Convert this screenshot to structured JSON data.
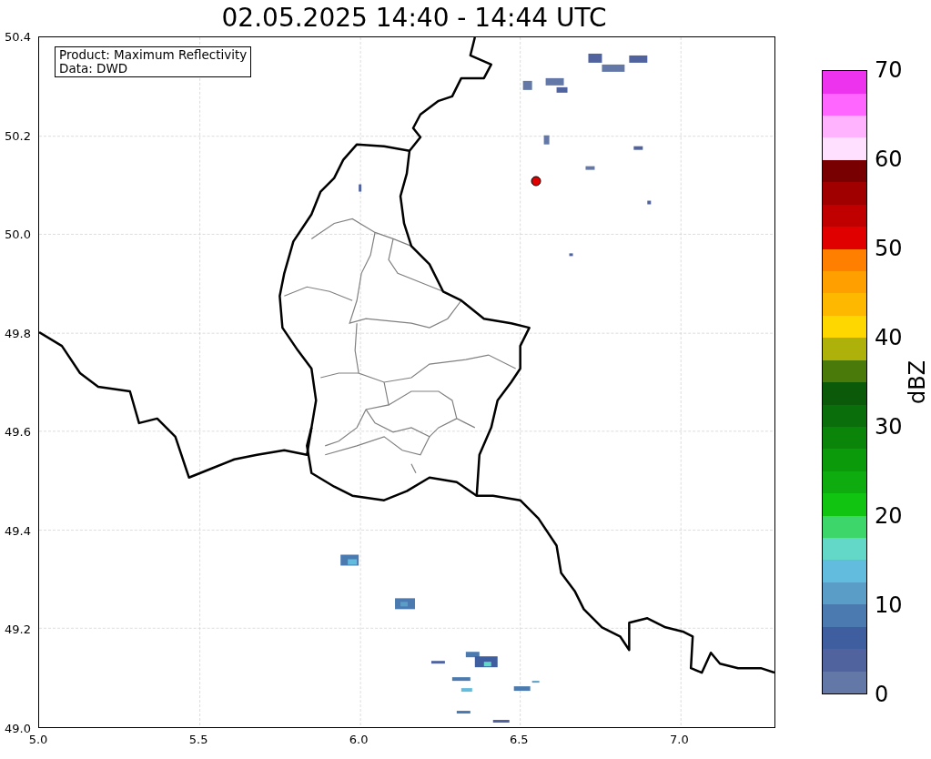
{
  "title": "02.05.2025 14:40 - 14:44 UTC",
  "info_box": [
    "Product: Maximum Reflectivity",
    "Data: DWD"
  ],
  "x_ticks": [
    "5.0",
    "5.5",
    "6.0",
    "6.5",
    "7.0"
  ],
  "y_ticks": [
    "50.4",
    "50.2",
    "50.0",
    "49.8",
    "49.6",
    "49.4",
    "49.2",
    "49.0"
  ],
  "colorbar": {
    "label": "dBZ",
    "ticks": [
      "70",
      "60",
      "50",
      "40",
      "30",
      "20",
      "10",
      "0"
    ],
    "bands": [
      {
        "color": "#6478a8"
      },
      {
        "color": "#50639f"
      },
      {
        "color": "#3f5ea0"
      },
      {
        "color": "#4a7ab0"
      },
      {
        "color": "#5a9ec8"
      },
      {
        "color": "#62bcde"
      },
      {
        "color": "#63d7c8"
      },
      {
        "color": "#3dd66a"
      },
      {
        "color": "#12c412"
      },
      {
        "color": "#0eac0e"
      },
      {
        "color": "#0a9a0a"
      },
      {
        "color": "#0a850a"
      },
      {
        "color": "#0a6e0a"
      },
      {
        "color": "#0a5a0a"
      },
      {
        "color": "#4a7a0a"
      },
      {
        "color": "#adb10a"
      },
      {
        "color": "#ffd700"
      },
      {
        "color": "#ffb800"
      },
      {
        "color": "#ff9f00"
      },
      {
        "color": "#ff7f00"
      },
      {
        "color": "#e00000"
      },
      {
        "color": "#c00000"
      },
      {
        "color": "#a00000"
      },
      {
        "color": "#780000"
      },
      {
        "color": "#ffe0ff"
      },
      {
        "color": "#ffb3ff"
      },
      {
        "color": "#ff66ff"
      },
      {
        "color": "#ee33ee"
      }
    ]
  }
}
